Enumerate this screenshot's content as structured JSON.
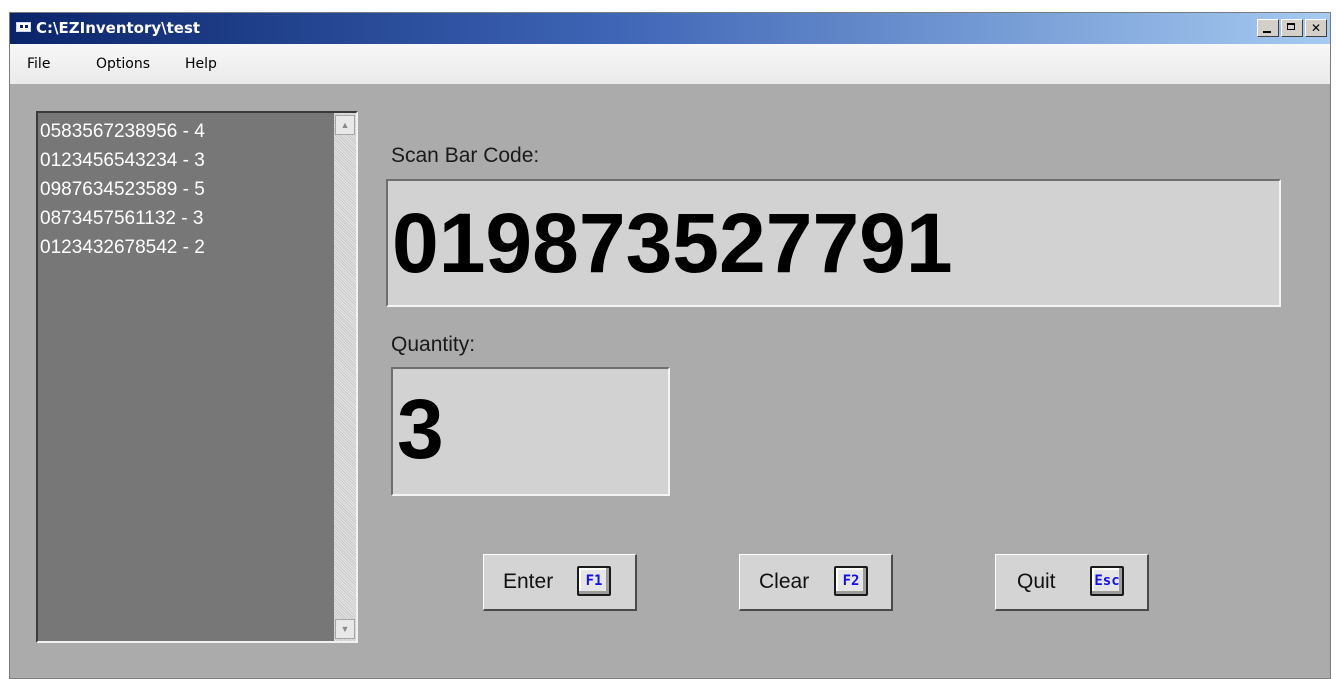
{
  "window": {
    "title": "C:\\EZInventory\\test"
  },
  "menu": {
    "items": [
      "File",
      "Options",
      "Help"
    ]
  },
  "scan_list": {
    "items": [
      "0583567238956 - 4",
      "0123456543234 - 3",
      "0987634523589 - 5",
      "0873457561132 - 3",
      "0123432678542 - 2"
    ]
  },
  "barcode": {
    "label": "Scan Bar Code:",
    "value": "019873527791"
  },
  "quantity": {
    "label": "Quantity:",
    "value": "3"
  },
  "buttons": {
    "enter": {
      "label": "Enter",
      "key": "F1"
    },
    "clear": {
      "label": "Clear",
      "key": "F2"
    },
    "quit": {
      "label": "Quit",
      "key": "Esc"
    }
  },
  "colors": {
    "titlebar_start": "#0a246a",
    "titlebar_end": "#a6caf0",
    "window_bg": "#ababab",
    "list_bg": "#777777",
    "key_text": "#1010ee"
  }
}
